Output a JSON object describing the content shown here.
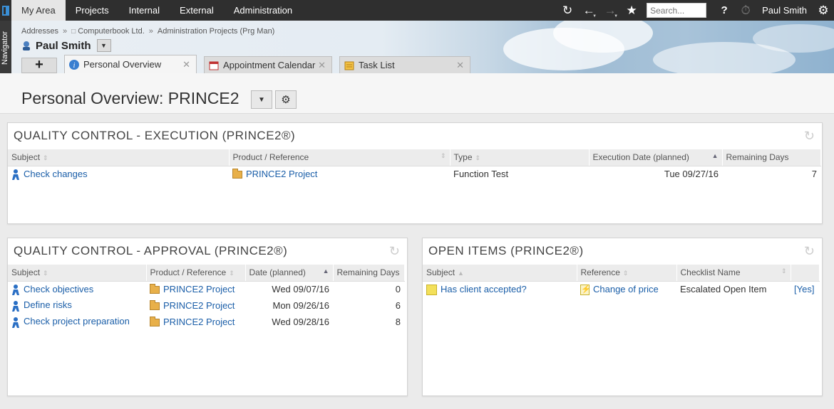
{
  "topbar": {
    "menu": [
      "My Area",
      "Projects",
      "Internal",
      "External",
      "Administration"
    ],
    "active_menu": "My Area",
    "search_placeholder": "Search...",
    "help_label": "?",
    "user_name": "Paul Smith"
  },
  "navigator": {
    "label": "Navigator"
  },
  "header": {
    "breadcrumb": [
      "Addresses",
      "Computerbook Ltd.",
      "Administration Projects (Prg Man)"
    ],
    "breadcrumb_sep": "»",
    "person_name": "Paul Smith"
  },
  "tabs": [
    {
      "label": "Personal Overview",
      "icon": "info-icon",
      "active": true
    },
    {
      "label": "Appointment Calendar",
      "icon": "calendar-icon",
      "active": false
    },
    {
      "label": "Task List",
      "icon": "task-list-icon",
      "active": false
    }
  ],
  "page": {
    "title": "Personal Overview: PRINCE2"
  },
  "panel_execution": {
    "title": "QUALITY CONTROL - EXECUTION (PRINCE2®)",
    "columns": [
      "Subject",
      "Product / Reference",
      "Type",
      "Execution Date (planned)",
      "Remaining Days"
    ],
    "rows": [
      {
        "subject": "Check changes",
        "reference": "PRINCE2 Project",
        "type": "Function Test",
        "date": "Tue 09/27/16",
        "remaining": "7"
      }
    ]
  },
  "panel_approval": {
    "title": "QUALITY CONTROL - APPROVAL (PRINCE2®)",
    "columns": [
      "Subject",
      "Product / Reference",
      "Date (planned)",
      "Remaining Days"
    ],
    "rows": [
      {
        "subject": "Check objectives",
        "reference": "PRINCE2 Project",
        "date": "Wed 09/07/16",
        "remaining": "0"
      },
      {
        "subject": "Define risks",
        "reference": "PRINCE2 Project",
        "date": "Mon 09/26/16",
        "remaining": "6"
      },
      {
        "subject": "Check project preparation",
        "reference": "PRINCE2 Project",
        "date": "Wed 09/28/16",
        "remaining": "8"
      }
    ]
  },
  "panel_open_items": {
    "title": "OPEN ITEMS (PRINCE2®)",
    "columns": [
      "Subject",
      "Reference",
      "Checklist Name",
      ""
    ],
    "rows": [
      {
        "subject": "Has client accepted?",
        "reference": "Change of price",
        "checklist": "Escalated Open Item",
        "flag": "[Yes]"
      }
    ]
  },
  "colors": {
    "topbar": "#2f2f2f",
    "link": "#1a5ea8",
    "header_gray": "#ececec"
  }
}
